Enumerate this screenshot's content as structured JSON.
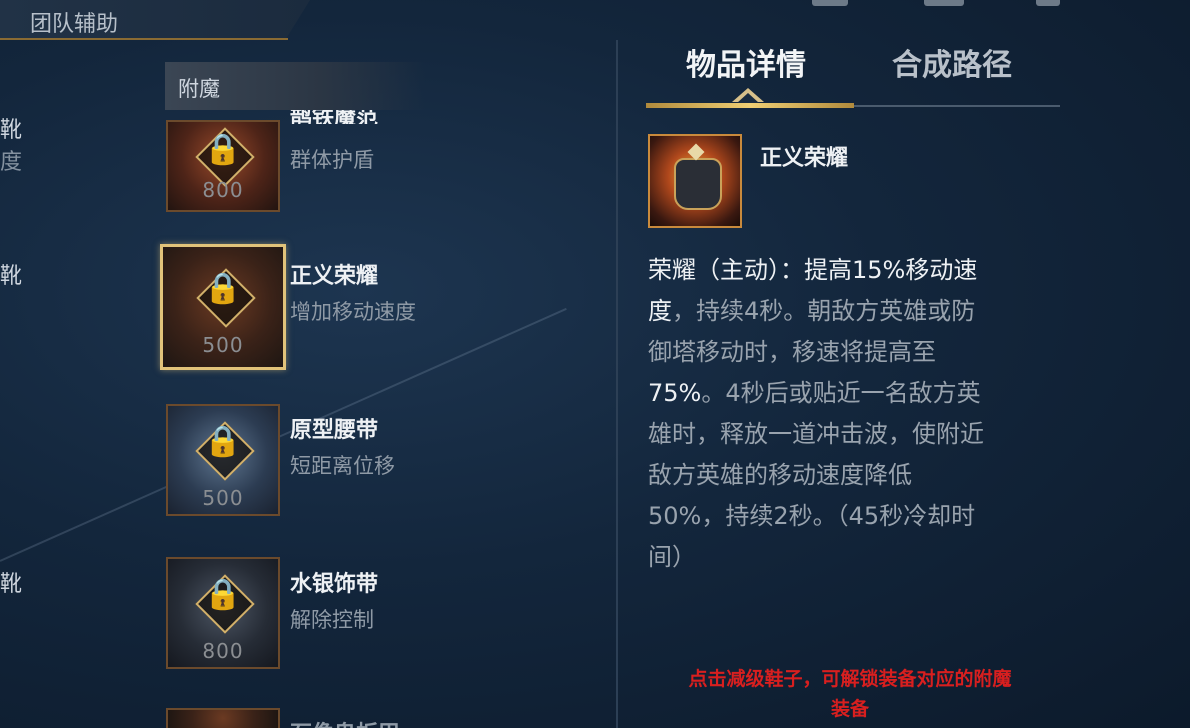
{
  "header": {
    "tag_label": "团队辅助"
  },
  "left_fragments": [
    {
      "text": "靴",
      "top": 0
    },
    {
      "text": "度",
      "top": 0
    },
    {
      "text": "靴",
      "top": 0
    },
    {
      "text": "靴",
      "top": 0
    }
  ],
  "list": {
    "section_label": "附魔",
    "partial_top_name": "鹊铁魔范",
    "partial_bottom_name": "石像鬼板甲",
    "items": [
      {
        "name": "",
        "desc": "群体护盾",
        "price": "800"
      },
      {
        "name": "正义荣耀",
        "desc": "增加移动速度",
        "price": "500",
        "selected": true
      },
      {
        "name": "原型腰带",
        "desc": "短距离位移",
        "price": "500"
      },
      {
        "name": "水银饰带",
        "desc": "解除控制",
        "price": "800"
      }
    ]
  },
  "detail": {
    "tabs": [
      {
        "label": "物品详情",
        "active": true
      },
      {
        "label": "合成路径",
        "active": false
      }
    ],
    "title": "正义荣耀",
    "description": {
      "l1_a": "荣耀（主动）：提高",
      "l1_b": "15%移动速",
      "l2_a": "度",
      "l2_b": "，持续4秒。朝敌方英雄或防",
      "l3": "御塔移动时，移速将提高至",
      "l4_a": "75%",
      "l4_b": "。4秒后或贴近一名敌方英",
      "l5": "雄时，释放一道冲击波，使附近",
      "l6": "敌方英雄的移动速度降低",
      "l7": "50%，持续2秒。（45秒冷却时",
      "l8": "间）"
    },
    "note_line1": "点击减级鞋子，可解锁装备对应的附魔",
    "note_line2": "装备"
  },
  "icons": {
    "lock": "lock-icon",
    "accent": "#e1c37a",
    "note_color": "#d81f1f"
  }
}
